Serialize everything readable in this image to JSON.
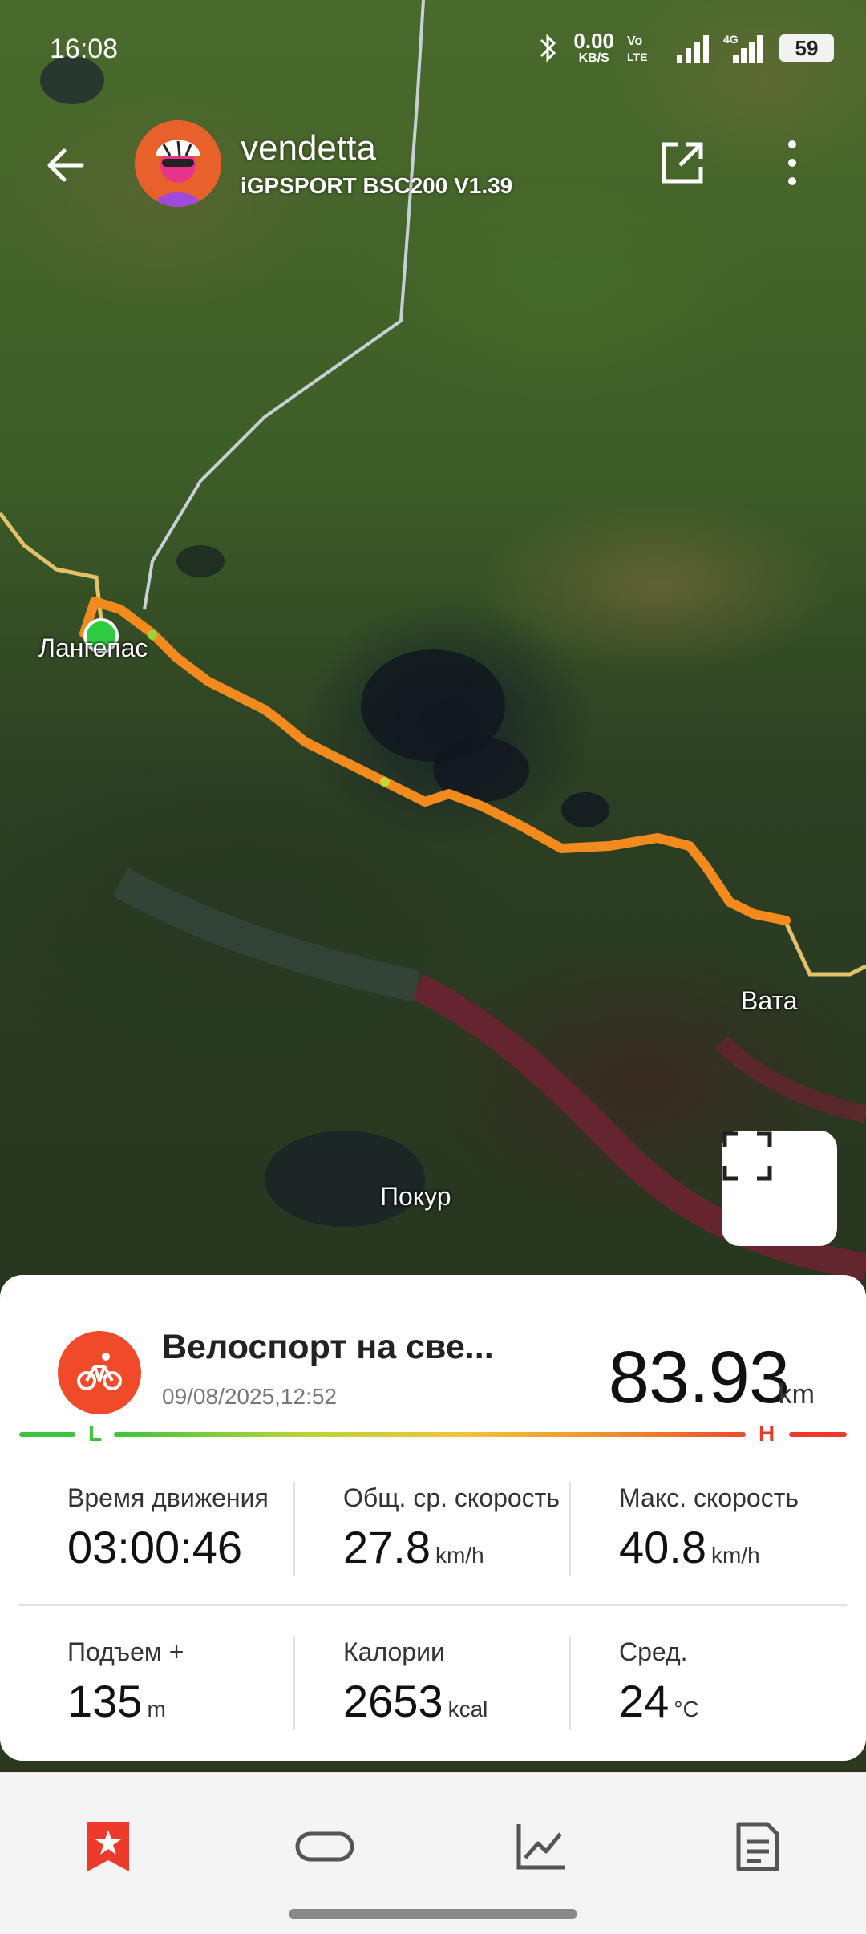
{
  "status_bar": {
    "time": "16:08",
    "net_speed_value": "0.00",
    "net_speed_unit": "KB/S",
    "battery": "59"
  },
  "header": {
    "user_name": "vendetta",
    "device": "iGPSPORT BSC200  V1.39"
  },
  "map": {
    "labels": {
      "langepas": "Лангепас",
      "vata": "Вата",
      "pokur": "Покур"
    },
    "route_color": "#f28a1e",
    "start_color": "#2ecc40"
  },
  "activity": {
    "title": "Велоспорт на све...",
    "datetime": "09/08/2025,12:52",
    "distance": "83.93",
    "distance_unit": "km",
    "scale_low": "L",
    "scale_high": "H",
    "accent": "#f04a2a"
  },
  "stats": {
    "moving_time": {
      "label": "Время движения",
      "value": "03:00:46",
      "unit": ""
    },
    "avg_speed": {
      "label": "Общ. ср. скорость",
      "value": "27.8",
      "unit": "km/h"
    },
    "max_speed": {
      "label": "Макс. скорость",
      "value": "40.8",
      "unit": "km/h"
    },
    "ascent": {
      "label": "Подъем +",
      "value": "135",
      "unit": "m"
    },
    "calories": {
      "label": "Калории",
      "value": "2653",
      "unit": "kcal"
    },
    "avg_temp": {
      "label": "Сред.",
      "value": "24",
      "unit": "°C"
    }
  },
  "nav": {
    "active_color": "#ee3a2a",
    "icons": [
      "bookmark-star-icon",
      "lap-icon",
      "chart-icon",
      "document-icon"
    ]
  }
}
